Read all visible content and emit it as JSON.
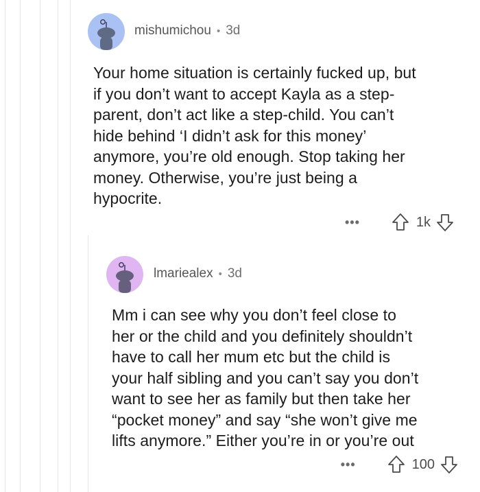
{
  "comments": [
    {
      "author": "mishumichou",
      "separator": "•",
      "age": "3d",
      "avatar_color": "#a9c1f3",
      "body": "Your home situation is certainly fucked up, but\nif you don’t want to accept Kayla as a step-\nparent, don’t act like a step-child. You can’t\nhide behind ‘I didn’t ask for this money’\nanymore, you’re old enough. Stop taking her\nmoney. Otherwise, you’re just being a\nhypocrite.",
      "more_label": "•••",
      "score": "1k"
    },
    {
      "author": "lmariealex",
      "separator": "•",
      "age": "3d",
      "avatar_color": "#e0b6f2",
      "body": "Mm i can see why you don’t feel close to\nher or the child and you definitely shouldn’t\nhave to call her mum etc but the child is\nyour half sibling and you can’t say you don’t\nwant to see her as family but then take her\n“pocket money” and say “she won’t give me\nlifts anymore.” Either you’re in or you’re out",
      "more_label": "•••",
      "score": "100"
    }
  ],
  "icons": {
    "upvote": "upvote-arrow-icon",
    "downvote": "downvote-arrow-icon",
    "more": "more-options-icon",
    "avatar": "snoo-avatar-icon"
  }
}
